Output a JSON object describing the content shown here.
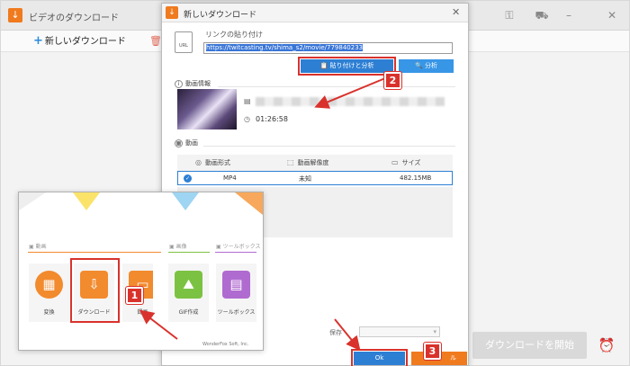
{
  "main": {
    "title": "ビデオのダウンロード",
    "new_download_label": "新しいダウンロード",
    "start_download_label": "ダウンロードを開始"
  },
  "dialog": {
    "title": "新しいダウンロード",
    "paste_label": "リンクの貼り付け",
    "url_value": "https://twitcasting.tv/shima_s2/movie/779840233",
    "paste_analyze_label": "貼り付けと分析",
    "analyze_label": "分析",
    "video_info_heading": "動画情報",
    "duration": "01:26:58",
    "video_heading": "動画",
    "format_table": {
      "headers": [
        "動画形式",
        "動画解像度",
        "サイズ"
      ],
      "rows": [
        {
          "format": "MP4",
          "resolution": "未知",
          "size": "482.15MB",
          "selected": true
        }
      ]
    },
    "save_label": "保存",
    "ok_label": "Ok",
    "cancel_label": "ル"
  },
  "launcher": {
    "categories": {
      "video": "動画",
      "image": "画像",
      "toolbox": "ツールボックス"
    },
    "tiles": [
      {
        "label": "変換",
        "icon": "film-icon",
        "color": "#f28a2e"
      },
      {
        "label": "ダウンロード",
        "icon": "download-icon",
        "color": "#f28a2e"
      },
      {
        "label": "録画",
        "icon": "record-icon",
        "color": "#f28a2e"
      },
      {
        "label": "GIF作成",
        "icon": "image-icon",
        "color": "#7cc242"
      },
      {
        "label": "ツールボックス",
        "icon": "toolbox-icon",
        "color": "#b06bd0"
      }
    ],
    "footer": "WonderFox Soft, Inc."
  },
  "steps": [
    "1",
    "2",
    "3"
  ],
  "colors": {
    "accent_blue": "#2d7fd4",
    "accent_orange": "#f07a1e",
    "highlight_red": "#d9322c"
  }
}
